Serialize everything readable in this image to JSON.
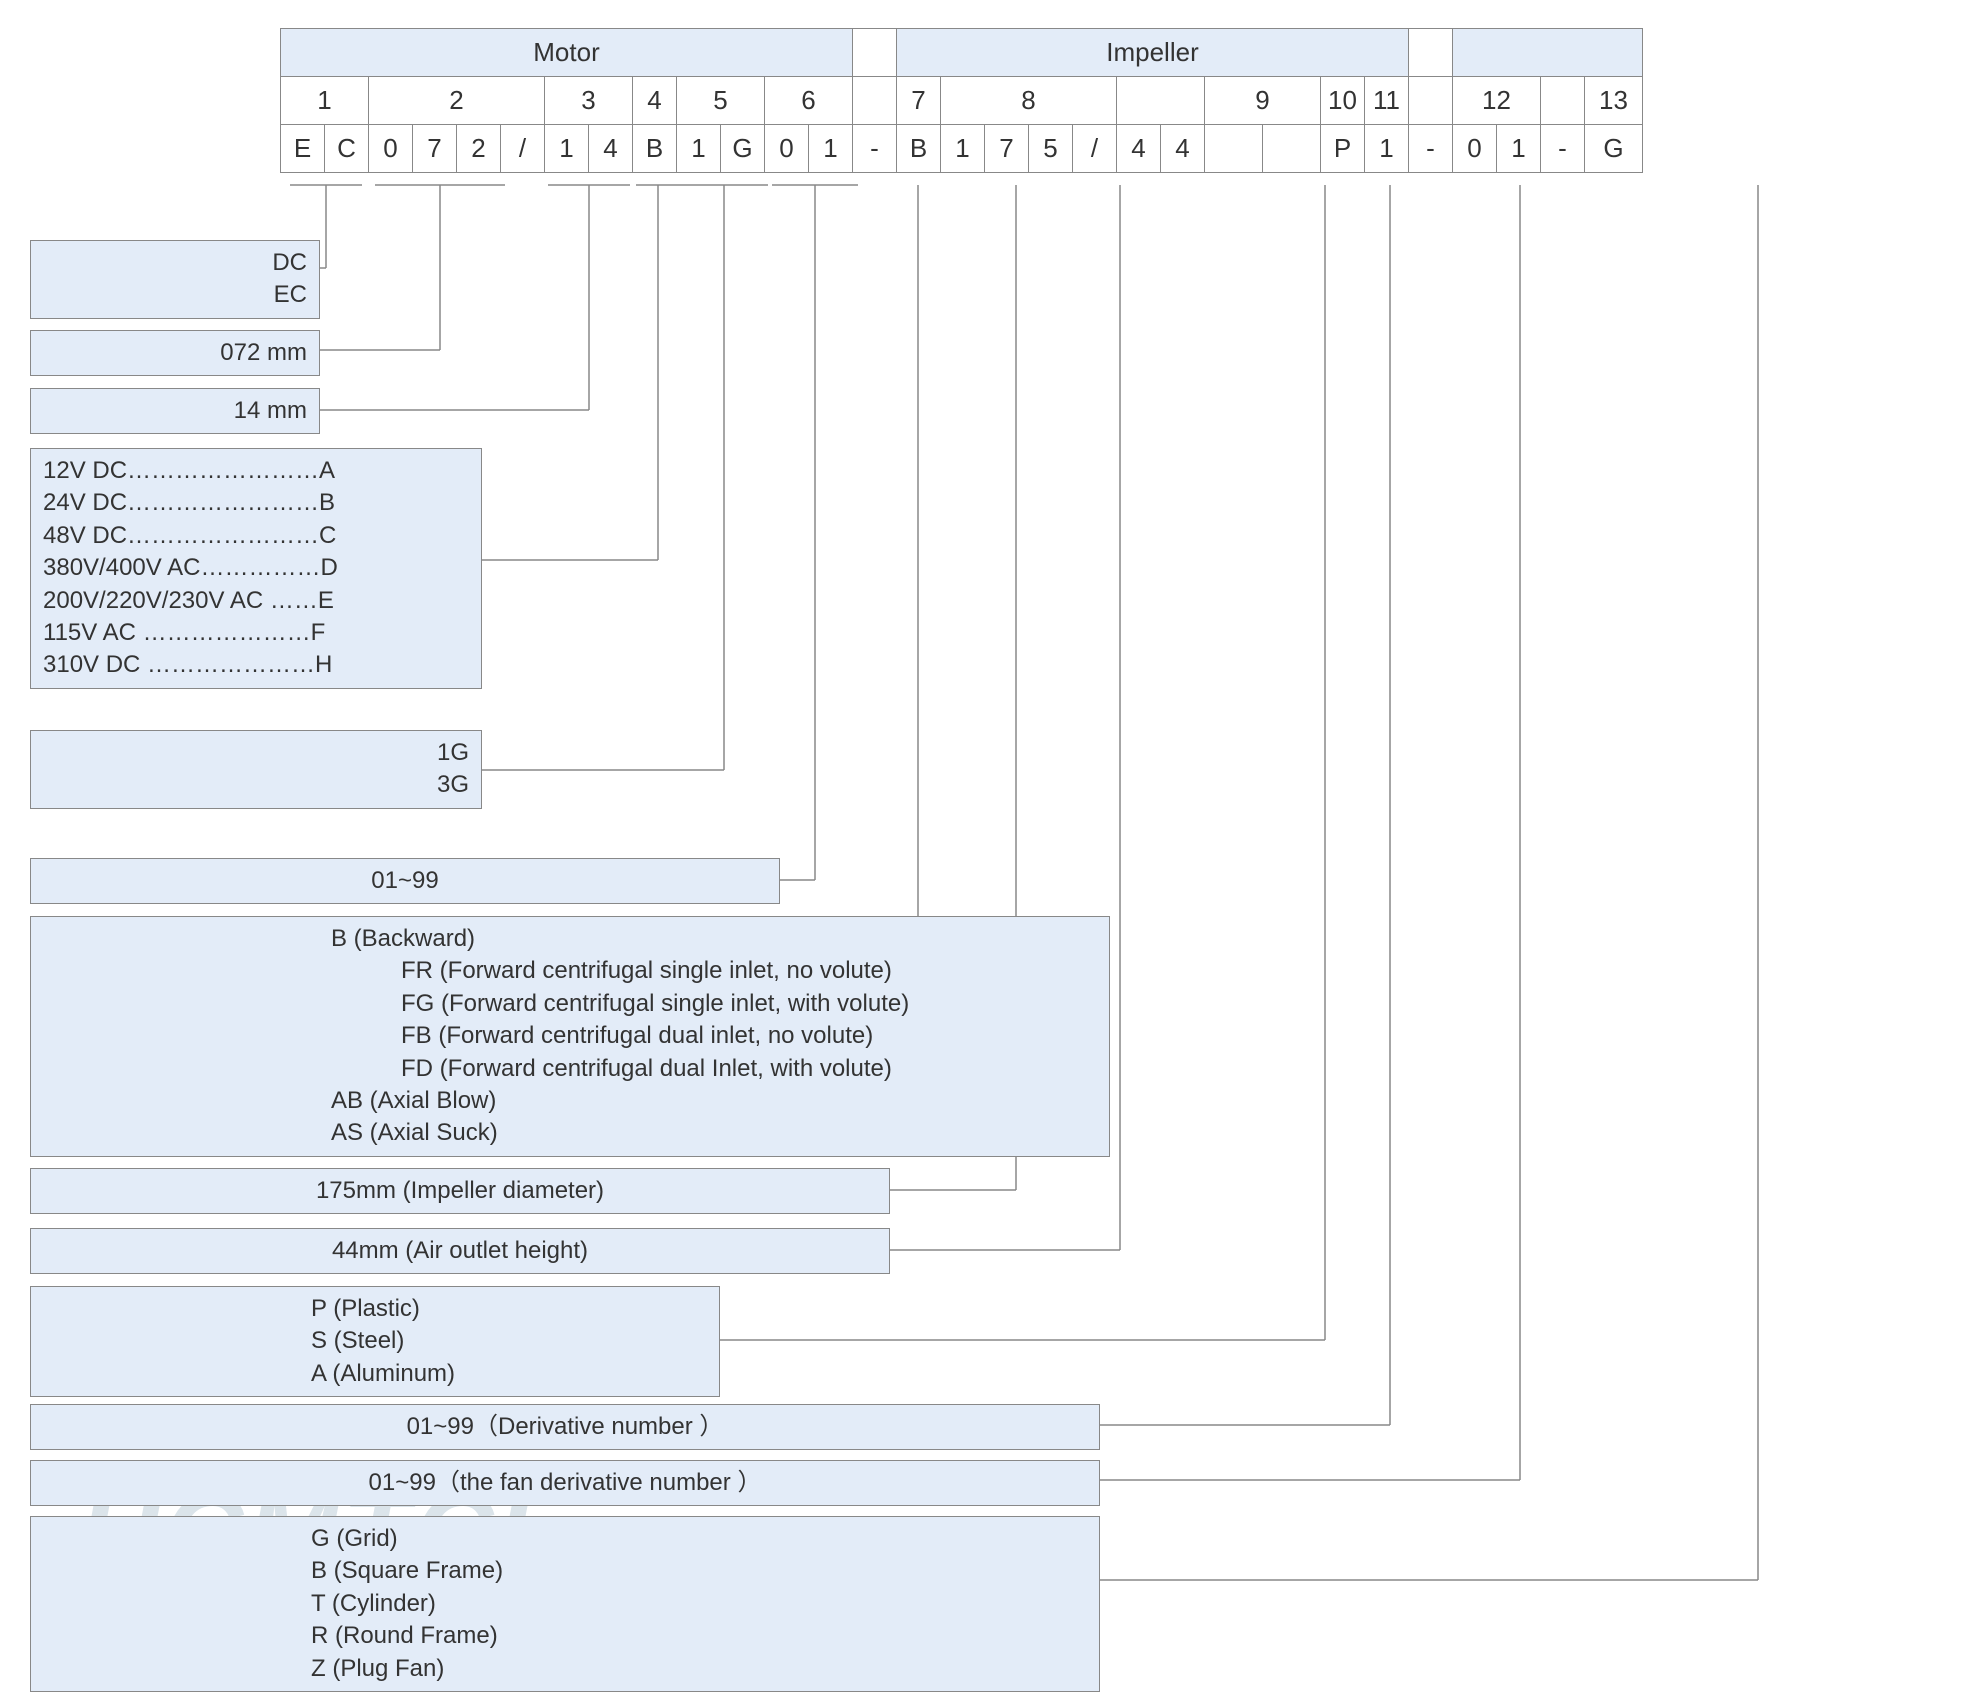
{
  "header": {
    "motor": "Motor",
    "impeller": "Impeller"
  },
  "nums": {
    "n1": "1",
    "n2": "2",
    "n3": "3",
    "n4": "4",
    "n5": "5",
    "n6": "6",
    "n7": "7",
    "n8": "8",
    "n9": "9",
    "n10": "10",
    "n11": "11",
    "n12": "12",
    "n13": "13"
  },
  "code": {
    "c0": "E",
    "c1": "C",
    "c2": "0",
    "c3": "7",
    "c4": "2",
    "c5": "/",
    "c6": "1",
    "c7": "4",
    "c8": "B",
    "c9": "1",
    "c10": "G",
    "c11": "0",
    "c12": "1",
    "d1": "-",
    "c13": "B",
    "c14": "1",
    "c15": "7",
    "c16": "5",
    "c17": "/",
    "c18": "4",
    "c19": "4",
    "c20": "P",
    "c21": "1",
    "d2": "-",
    "c22": "0",
    "c23": "1",
    "d3": "-",
    "c24": "G"
  },
  "legend": {
    "b1": {
      "l1": "DC",
      "l2": "EC"
    },
    "b2": "072 mm",
    "b3": "14 mm",
    "b4": {
      "l1": "12V DC……………………A",
      "l2": "24V DC……………………B",
      "l3": "48V DC……………………C",
      "l4": "380V/400V AC……………D",
      "l5": "200V/220V/230V AC ……E",
      "l6": "115V AC …………………F",
      "l7": "310V DC …………………H"
    },
    "b5": {
      "l1": "1G",
      "l2": "3G"
    },
    "b6": "01~99",
    "b7": {
      "l1": "B (Backward)",
      "l2": "FR (Forward centrifugal single inlet, no volute)",
      "l3": "FG (Forward centrifugal single inlet, with volute)",
      "l4": "FB (Forward centrifugal dual inlet, no volute)",
      "l5": "FD (Forward centrifugal dual Inlet, with volute)",
      "l6": "AB (Axial Blow)",
      "l7": "AS (Axial Suck)"
    },
    "b8": "175mm (Impeller diameter)",
    "b9": "44mm (Air outlet height)",
    "b10": {
      "l1": "P (Plastic)",
      "l2": "S (Steel)",
      "l3": "A (Aluminum)"
    },
    "b11": "01~99（Derivative number ）",
    "b12": "01~99（the fan derivative number ）",
    "b13": {
      "l1": "G (Grid)",
      "l2": "B (Square Frame)",
      "l3": "T (Cylinder)",
      "l4": "R (Round Frame)",
      "l5": "Z (Plug Fan)"
    }
  }
}
